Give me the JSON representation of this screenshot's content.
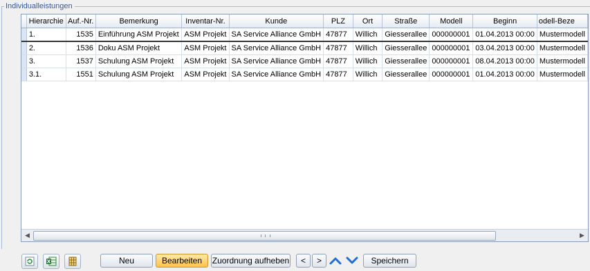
{
  "group": {
    "title": "Individualleistungen"
  },
  "grid": {
    "columns": [
      "Hierarchie",
      "Auf.-Nr.",
      "Bemerkung",
      "Inventar-Nr.",
      "Kunde",
      "PLZ",
      "Ort",
      "Straße",
      "Modell",
      "Beginn",
      "odell-Beze"
    ],
    "rows": [
      [
        "1.",
        "1535",
        "Einführung ASM Projekt",
        "ASM Projekt",
        "SA Service Alliance GmbH",
        "47877",
        "Willich",
        "Giesserallee",
        "000000001",
        "01.04.2013 00:00",
        "Mustermodell"
      ],
      [
        "2.",
        "1536",
        "Doku ASM Projekt",
        "ASM Projekt",
        "SA Service Alliance GmbH",
        "47877",
        "Willich",
        "Giesserallee",
        "000000001",
        "03.04.2013 00:00",
        "Mustermodell"
      ],
      [
        "3.",
        "1537",
        "Schulung ASM Projekt",
        "ASM Projekt",
        "SA Service Alliance GmbH",
        "47877",
        "Willich",
        "Giesserallee",
        "000000001",
        "08.04.2013 00:00",
        "Mustermodell"
      ],
      [
        "3.1.",
        "1551",
        "Schulung ASM Projekt",
        "ASM Projekt",
        "SA Service Alliance GmbH",
        "47877",
        "Willich",
        "Giesserallee",
        "000000001",
        "01.04.2013 00:00",
        "Mustermodell"
      ]
    ],
    "selected_row": 0
  },
  "toolbar": {
    "icons": [
      "refresh-icon",
      "excel-export-icon",
      "column-chooser-icon"
    ],
    "new_label": "Neu",
    "edit_label": "Bearbeiten",
    "unassign_label": "Zuordnung aufheben",
    "prev_label": "<",
    "next_label": ">",
    "save_label": "Speichern"
  },
  "colors": {
    "accent": "#3b5998",
    "active_button": "#ffc24a",
    "arrow_blue": "#1f6fd1"
  }
}
